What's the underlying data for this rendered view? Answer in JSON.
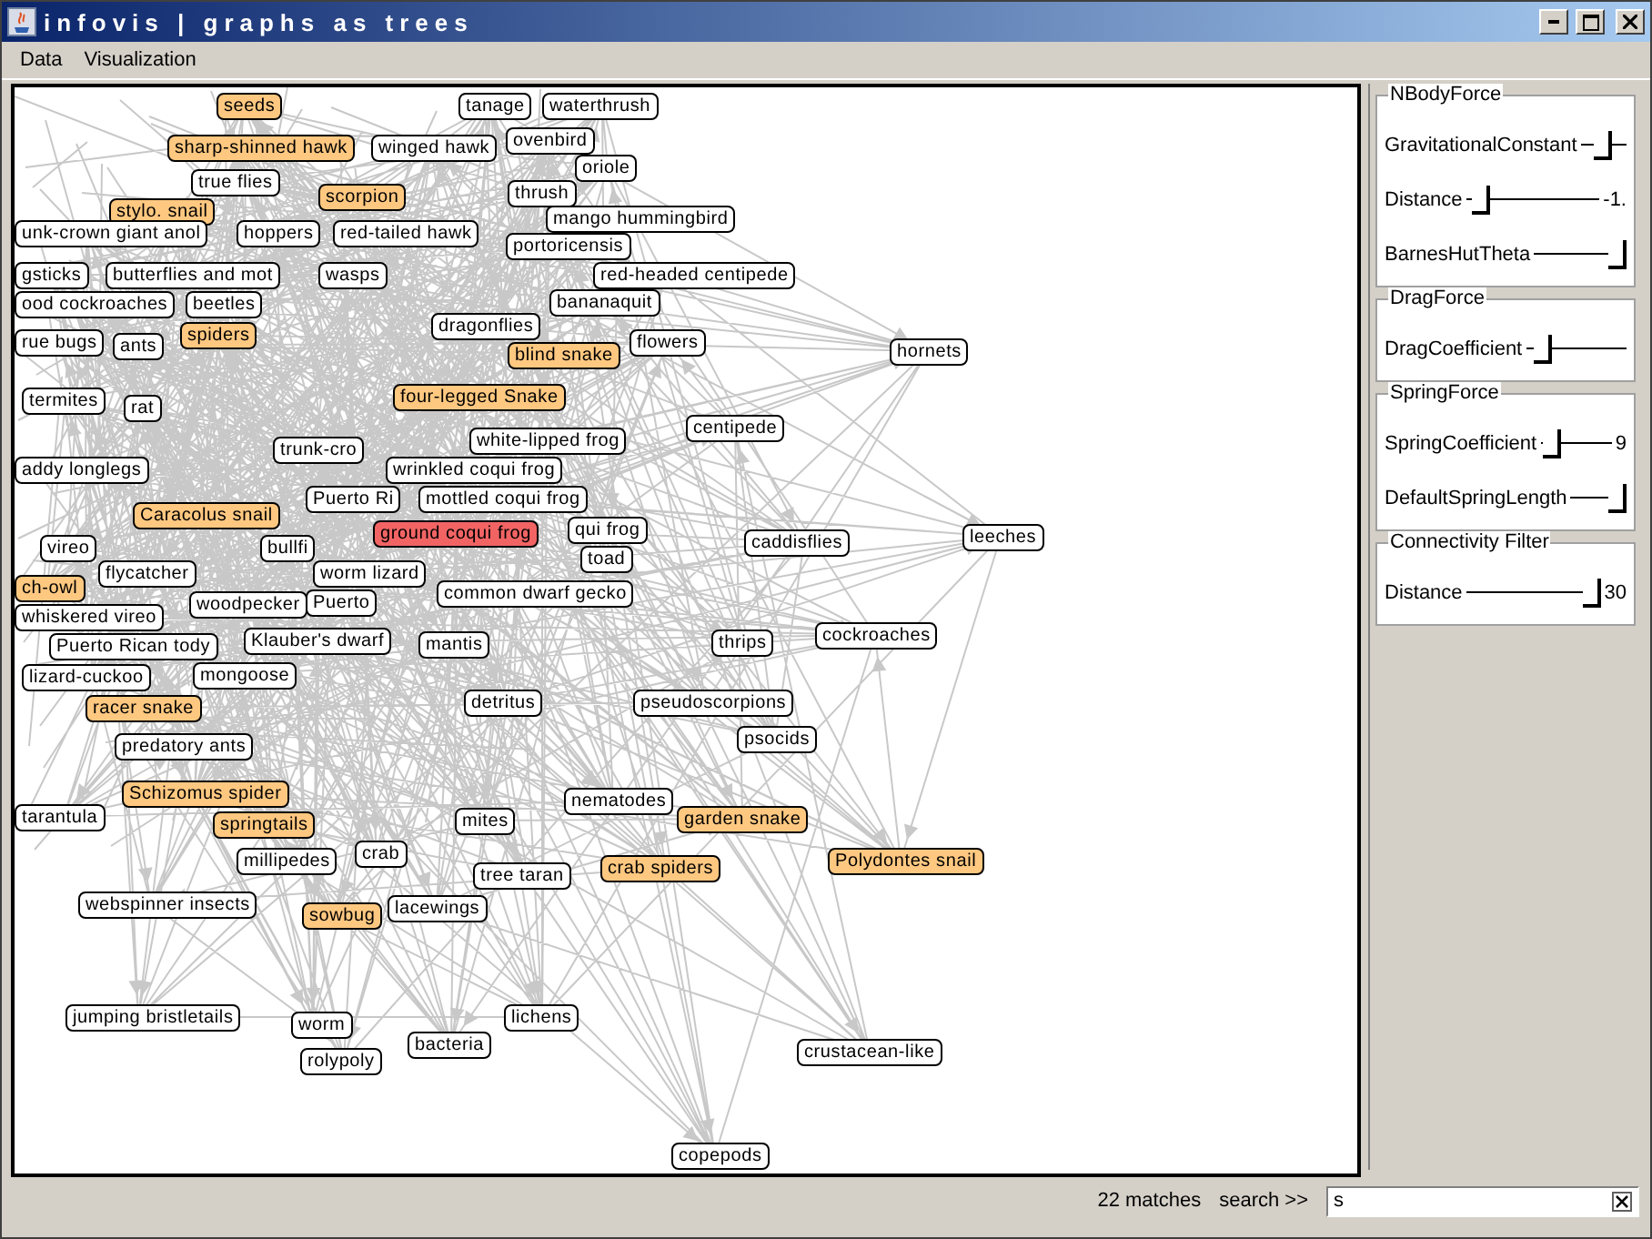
{
  "window": {
    "title": "infovis | graphs as trees"
  },
  "menu": [
    "Data",
    "Visualization"
  ],
  "graph": {
    "nodes": [
      {
        "label": "seeds",
        "match": true,
        "selected": false
      },
      {
        "label": "tanage",
        "match": false,
        "selected": false
      },
      {
        "label": "waterthrush",
        "match": false,
        "selected": false
      },
      {
        "label": "sharp-shinned hawk",
        "match": true,
        "selected": false
      },
      {
        "label": "winged hawk",
        "match": false,
        "selected": false
      },
      {
        "label": "ovenbird",
        "match": false,
        "selected": false
      },
      {
        "label": "oriole",
        "match": false,
        "selected": false
      },
      {
        "label": "true flies",
        "match": false,
        "selected": false
      },
      {
        "label": "stylo. snail",
        "match": true,
        "selected": false
      },
      {
        "label": "scorpion",
        "match": true,
        "selected": false
      },
      {
        "label": "thrush",
        "match": false,
        "selected": false
      },
      {
        "label": "unk-crown giant anol",
        "match": false,
        "selected": false
      },
      {
        "label": "hoppers",
        "match": false,
        "selected": false
      },
      {
        "label": "red-tailed hawk",
        "match": false,
        "selected": false
      },
      {
        "label": "mango hummingbird",
        "match": false,
        "selected": false
      },
      {
        "label": "portoricensis",
        "match": false,
        "selected": false
      },
      {
        "label": "gsticks",
        "match": false,
        "selected": false
      },
      {
        "label": "butterflies and mot",
        "match": false,
        "selected": false
      },
      {
        "label": "wasps",
        "match": false,
        "selected": false
      },
      {
        "label": "red-headed centipede",
        "match": false,
        "selected": false
      },
      {
        "label": "ood cockroaches",
        "match": false,
        "selected": false
      },
      {
        "label": "beetles",
        "match": false,
        "selected": false
      },
      {
        "label": "bananaquit",
        "match": false,
        "selected": false
      },
      {
        "label": "rue bugs",
        "match": false,
        "selected": false
      },
      {
        "label": "ants",
        "match": false,
        "selected": false
      },
      {
        "label": "spiders",
        "match": true,
        "selected": false
      },
      {
        "label": "dragonflies",
        "match": false,
        "selected": false
      },
      {
        "label": "blind snake",
        "match": true,
        "selected": false
      },
      {
        "label": "flowers",
        "match": false,
        "selected": false
      },
      {
        "label": "hornets",
        "match": false,
        "selected": false
      },
      {
        "label": "termites",
        "match": false,
        "selected": false
      },
      {
        "label": "rat",
        "match": false,
        "selected": false
      },
      {
        "label": "four-legged Snake",
        "match": true,
        "selected": false
      },
      {
        "label": "addy longlegs",
        "match": false,
        "selected": false
      },
      {
        "label": "trunk-cro",
        "match": false,
        "selected": false
      },
      {
        "label": "white-lipped frog",
        "match": false,
        "selected": false
      },
      {
        "label": "centipede",
        "match": false,
        "selected": false
      },
      {
        "label": "wrinkled coqui frog",
        "match": false,
        "selected": false
      },
      {
        "label": "Puerto Ri",
        "match": false,
        "selected": false
      },
      {
        "label": "mottled coqui frog",
        "match": false,
        "selected": false
      },
      {
        "label": "Caracolus snail",
        "match": true,
        "selected": false
      },
      {
        "label": "vireo",
        "match": false,
        "selected": false
      },
      {
        "label": "bullfi",
        "match": false,
        "selected": false
      },
      {
        "label": "ground coqui frog",
        "match": false,
        "selected": true
      },
      {
        "label": "qui frog",
        "match": false,
        "selected": false
      },
      {
        "label": "toad",
        "match": false,
        "selected": false
      },
      {
        "label": "caddisflies",
        "match": false,
        "selected": false
      },
      {
        "label": "leeches",
        "match": false,
        "selected": false
      },
      {
        "label": "ch-owl",
        "match": true,
        "selected": false
      },
      {
        "label": "flycatcher",
        "match": false,
        "selected": false
      },
      {
        "label": "worm lizard",
        "match": false,
        "selected": false
      },
      {
        "label": "whiskered vireo",
        "match": false,
        "selected": false
      },
      {
        "label": "woodpecker",
        "match": false,
        "selected": false
      },
      {
        "label": "Puerto",
        "match": false,
        "selected": false
      },
      {
        "label": "common dwarf gecko",
        "match": false,
        "selected": false
      },
      {
        "label": "Puerto Rican tody",
        "match": false,
        "selected": false
      },
      {
        "label": "Klauber's dwarf",
        "match": false,
        "selected": false
      },
      {
        "label": "mantis",
        "match": false,
        "selected": false
      },
      {
        "label": "thrips",
        "match": false,
        "selected": false
      },
      {
        "label": "cockroaches",
        "match": false,
        "selected": false
      },
      {
        "label": "lizard-cuckoo",
        "match": false,
        "selected": false
      },
      {
        "label": "mongoose",
        "match": false,
        "selected": false
      },
      {
        "label": "racer snake",
        "match": true,
        "selected": false
      },
      {
        "label": "detritus",
        "match": false,
        "selected": false
      },
      {
        "label": "pseudoscorpions",
        "match": false,
        "selected": false
      },
      {
        "label": "predatory ants",
        "match": false,
        "selected": false
      },
      {
        "label": "psocids",
        "match": false,
        "selected": false
      },
      {
        "label": "tarantula",
        "match": false,
        "selected": false
      },
      {
        "label": "Schizomus spider",
        "match": true,
        "selected": false
      },
      {
        "label": "springtails",
        "match": true,
        "selected": false
      },
      {
        "label": "mites",
        "match": false,
        "selected": false
      },
      {
        "label": "nematodes",
        "match": false,
        "selected": false
      },
      {
        "label": "garden snake",
        "match": true,
        "selected": false
      },
      {
        "label": "millipedes",
        "match": false,
        "selected": false
      },
      {
        "label": "crab",
        "match": false,
        "selected": false
      },
      {
        "label": "tree taran",
        "match": false,
        "selected": false
      },
      {
        "label": "crab spiders",
        "match": true,
        "selected": false
      },
      {
        "label": "Polydontes snail",
        "match": true,
        "selected": false
      },
      {
        "label": "webspinner insects",
        "match": false,
        "selected": false
      },
      {
        "label": "sowbug",
        "match": true,
        "selected": false
      },
      {
        "label": "lacewings",
        "match": false,
        "selected": false
      },
      {
        "label": "jumping bristletails",
        "match": false,
        "selected": false
      },
      {
        "label": "worm",
        "match": false,
        "selected": false
      },
      {
        "label": "lichens",
        "match": false,
        "selected": false
      },
      {
        "label": "rolypoly",
        "match": false,
        "selected": false
      },
      {
        "label": "bacteria",
        "match": false,
        "selected": false
      },
      {
        "label": "crustacean-like",
        "match": false,
        "selected": false
      },
      {
        "label": "copepods",
        "match": false,
        "selected": false
      }
    ]
  },
  "panel": {
    "groups": [
      {
        "title": "NBodyForce",
        "sliders": [
          {
            "label": "GravitationalConstant",
            "level": 0.5
          },
          {
            "label": "Distance",
            "level": 0.05,
            "value": "-1."
          },
          {
            "label": "BarnesHutTheta",
            "level": 1
          }
        ]
      },
      {
        "title": "DragForce",
        "sliders": [
          {
            "label": "DragCoefficient",
            "level": 0.1
          }
        ]
      },
      {
        "title": "SpringForce",
        "sliders": [
          {
            "label": "SpringCoefficient",
            "level": 0.05,
            "value": "9"
          },
          {
            "label": "DefaultSpringLength",
            "level": 1
          }
        ]
      },
      {
        "title": "Connectivity Filter",
        "sliders": [
          {
            "label": "Distance",
            "level": 1,
            "value": "30"
          }
        ]
      }
    ]
  },
  "status": {
    "matches": "22 matches",
    "search_label": "search >>",
    "search_value": "s"
  }
}
